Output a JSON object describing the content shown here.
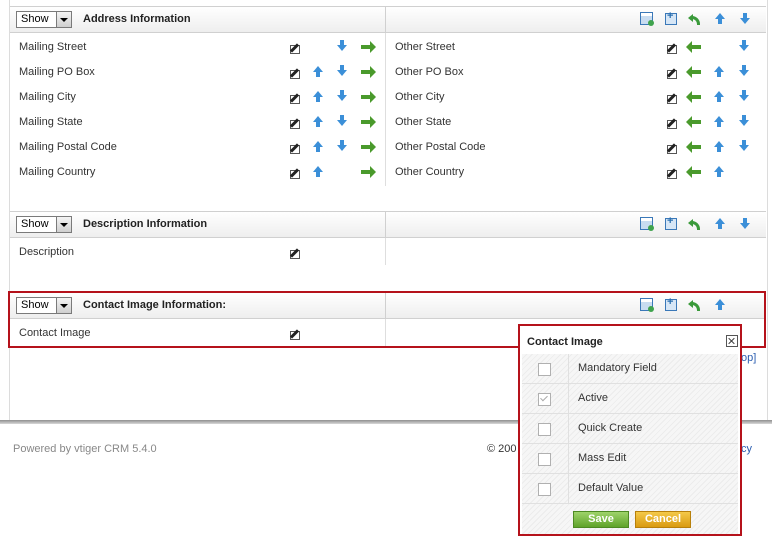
{
  "show_label": "Show",
  "blocks": {
    "address": {
      "title": "Address Information",
      "left_rows": [
        "Mailing Street",
        "Mailing PO Box",
        "Mailing City",
        "Mailing State",
        "Mailing Postal Code",
        "Mailing Country"
      ],
      "right_rows": [
        "Other Street",
        "Other PO Box",
        "Other City",
        "Other State",
        "Other Postal Code",
        "Other Country"
      ]
    },
    "description": {
      "title": "Description Information",
      "rows": [
        "Description"
      ]
    },
    "contact_image": {
      "title": "Contact Image Information:",
      "rows": [
        "Contact Image"
      ]
    }
  },
  "popup": {
    "title": "Contact Image",
    "options": [
      {
        "label": "Mandatory Field",
        "checked": false
      },
      {
        "label": "Active",
        "checked": true
      },
      {
        "label": "Quick Create",
        "checked": false
      },
      {
        "label": "Mass Edit",
        "checked": false
      },
      {
        "label": "Default Value",
        "checked": false
      }
    ],
    "save_label": "Save",
    "cancel_label": "Cancel"
  },
  "link_fragment": "op]",
  "footer": {
    "powered_by": "Powered by vtiger CRM 5.4.0",
    "copyright_fragment": "© 200",
    "right_fragment": "cy"
  },
  "colors": {
    "highlight_border": "#b5121b",
    "save_button": "#6bb134",
    "cancel_button": "#e0a515",
    "arrow_blue": "#3b8fd8",
    "arrow_green": "#4a9a2c"
  },
  "icons": [
    "edit-icon",
    "move-up-icon",
    "move-down-icon",
    "move-right-icon",
    "move-left-icon",
    "add-block-icon",
    "add-field-icon",
    "undo-icon"
  ]
}
